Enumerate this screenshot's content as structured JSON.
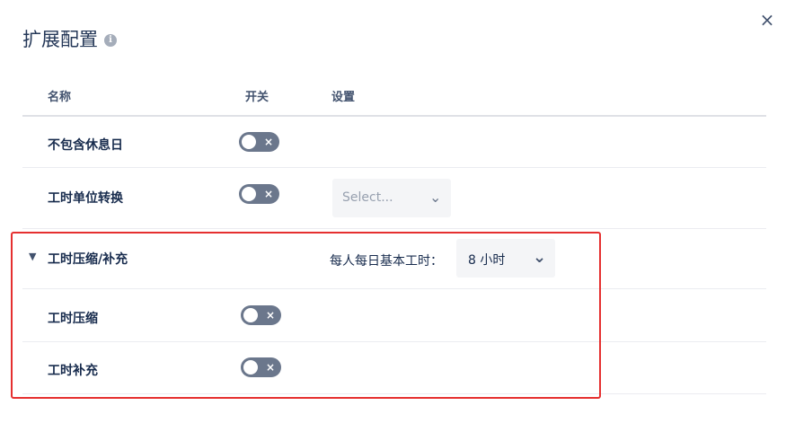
{
  "dialog": {
    "title": "扩展配置",
    "info_icon": "info-icon",
    "close_label": "×"
  },
  "table": {
    "headers": [
      "名称",
      "开关",
      "设置"
    ],
    "rows": {
      "exclude_rest_days": {
        "label": "不包含休息日",
        "toggle_on": false
      },
      "unit_conversion": {
        "label": "工时单位转换",
        "toggle_on": false,
        "select_placeholder": "Select..."
      },
      "compress_supplement": {
        "label": "工时压缩/补充",
        "expanded": true,
        "setting_label": "每人每日基本工时：",
        "setting_value": "8 小时"
      },
      "compress": {
        "label": "工时压缩",
        "toggle_on": false
      },
      "supplement": {
        "label": "工时补充",
        "toggle_on": false
      }
    }
  },
  "icons": {
    "toggle_off": "×",
    "chevron_down": "⌄"
  },
  "colors": {
    "toggle_off": "#6b778c",
    "highlight_border": "#e53030",
    "select_bg": "#f4f5f7"
  }
}
